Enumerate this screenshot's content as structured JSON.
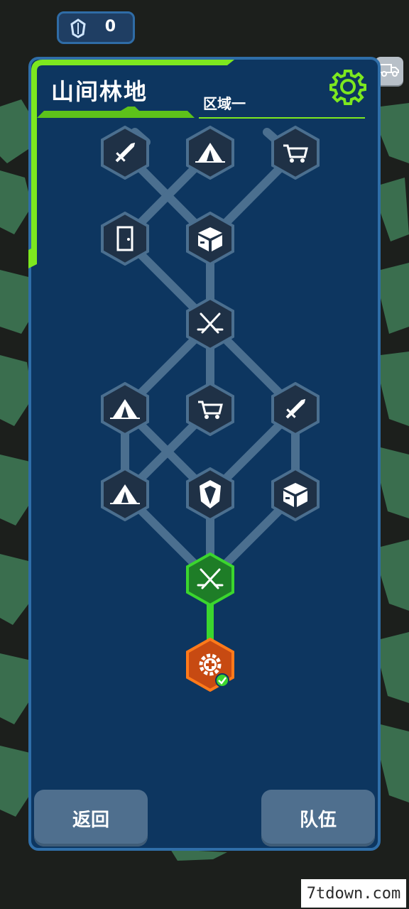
{
  "currency": {
    "icon": "crystal-icon",
    "value": "0"
  },
  "header": {
    "title": "山间林地",
    "subtitle": "区域一",
    "settings_icon": "gear-icon"
  },
  "top_right_icon": "truck-icon",
  "map": {
    "nodes": [
      {
        "id": "r1c1",
        "icon": "sword-icon",
        "state": "locked"
      },
      {
        "id": "r1c2",
        "icon": "tent-icon",
        "state": "locked"
      },
      {
        "id": "r1c3",
        "icon": "cart-icon",
        "state": "locked"
      },
      {
        "id": "r2c1",
        "icon": "door-icon",
        "state": "locked"
      },
      {
        "id": "r2c2",
        "icon": "box-icon",
        "state": "locked"
      },
      {
        "id": "r3c2",
        "icon": "crossed-swords-icon",
        "state": "locked"
      },
      {
        "id": "r4c1",
        "icon": "tent-icon",
        "state": "locked"
      },
      {
        "id": "r4c2",
        "icon": "cart-icon",
        "state": "locked"
      },
      {
        "id": "r4c3",
        "icon": "sword-icon",
        "state": "locked"
      },
      {
        "id": "r5c1",
        "icon": "tent-icon",
        "state": "locked"
      },
      {
        "id": "r5c2",
        "icon": "crystal-icon",
        "state": "locked"
      },
      {
        "id": "r5c3",
        "icon": "box-icon",
        "state": "locked"
      },
      {
        "id": "r6c2",
        "icon": "crossed-swords-icon",
        "state": "available"
      },
      {
        "id": "r7c2",
        "icon": "gear-plus-icon",
        "state": "completed"
      }
    ]
  },
  "buttons": {
    "back": "返回",
    "team": "队伍"
  },
  "watermark": "7tdown.com",
  "colors": {
    "accent_green": "#7de81f",
    "panel": "#0d3660",
    "node_locked": "#1f3146",
    "node_available": "#1e7d27",
    "node_current": "#c74a12"
  }
}
